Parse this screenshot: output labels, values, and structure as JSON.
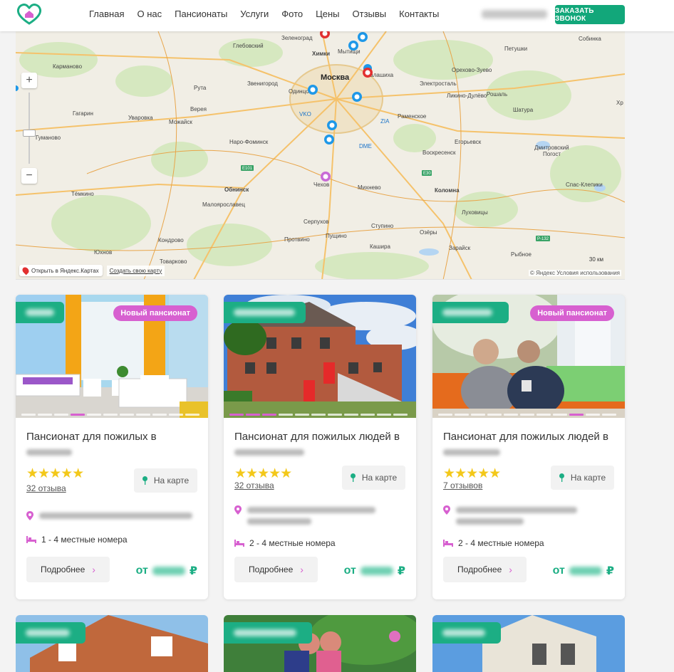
{
  "header": {
    "nav": [
      "Главная",
      "О нас",
      "Пансионаты",
      "Услуги",
      "Фото",
      "Цены",
      "Отзывы",
      "Контакты"
    ],
    "call_button": "ЗАКАЗАТЬ ЗВОНОК"
  },
  "map": {
    "zoom_in": "+",
    "zoom_out": "−",
    "open_yandex": "Открыть в Яндекс.Картах",
    "create_map": "Создать свою карту",
    "copyright": "© Яндекс Условия использования",
    "scale": "30 км",
    "cities": [
      "Зеленоград",
      "Химки",
      "Мытищи",
      "Балашиха",
      "Москва",
      "Одинцово",
      "Рута",
      "Звенигород",
      "Кармановo",
      "Гагарин",
      "Уваровка",
      "Можайск",
      "Верея",
      "Наро-Фоминск",
      "Гуманово",
      "Тёмкино",
      "Обнинск",
      "Малоярославец",
      "Кондрово",
      "Юхнов",
      "Товарково",
      "Серпухов",
      "Пущино",
      "Протвино",
      "Чехов",
      "Михнево",
      "Ступино",
      "Кашира",
      "Озёры",
      "Зарайск",
      "Коломна",
      "Луховицы",
      "Раменское",
      "Электросталь",
      "Орехово-Зуево",
      "Петушки",
      "Собинка",
      "Ликино-Дулёво",
      "Рошаль",
      "Шатура",
      "Егорьевск",
      "Воскресенск",
      "Спас-Клепики",
      "Рыбное",
      "Дмитровский Погост",
      "Хр",
      "Глебовский"
    ],
    "airports": [
      "VKO",
      "DME",
      "ZIA"
    ],
    "roads": [
      "E101",
      "E30",
      "P-132"
    ]
  },
  "cards": [
    {
      "new_badge": "Новый пансионат",
      "title": "Пансионат для пожилых в",
      "stars": "★★★★★",
      "reviews": "32 отзыва",
      "map_button": "На карте",
      "rooms": "1 - 4 местные номера",
      "more": "Подробнее",
      "price_prefix": "от",
      "currency": "₽"
    },
    {
      "new_badge": "",
      "title": "Пансионат для пожилых людей в",
      "stars": "★★★★★",
      "reviews": "32 отзыва",
      "map_button": "На карте",
      "rooms": "2 - 4 местные номера",
      "more": "Подробнее",
      "price_prefix": "от",
      "currency": "₽"
    },
    {
      "new_badge": "Новый пансионат",
      "title": "Пансионат для пожилых людей в",
      "stars": "★★★★★",
      "reviews": "7 отзывов",
      "map_button": "На карте",
      "rooms": "2 - 4 местные номера",
      "more": "Подробнее",
      "price_prefix": "от",
      "currency": "₽"
    }
  ],
  "colors": {
    "brand": "#1cae84",
    "accent": "#d760d0",
    "star": "#f3c81a"
  }
}
